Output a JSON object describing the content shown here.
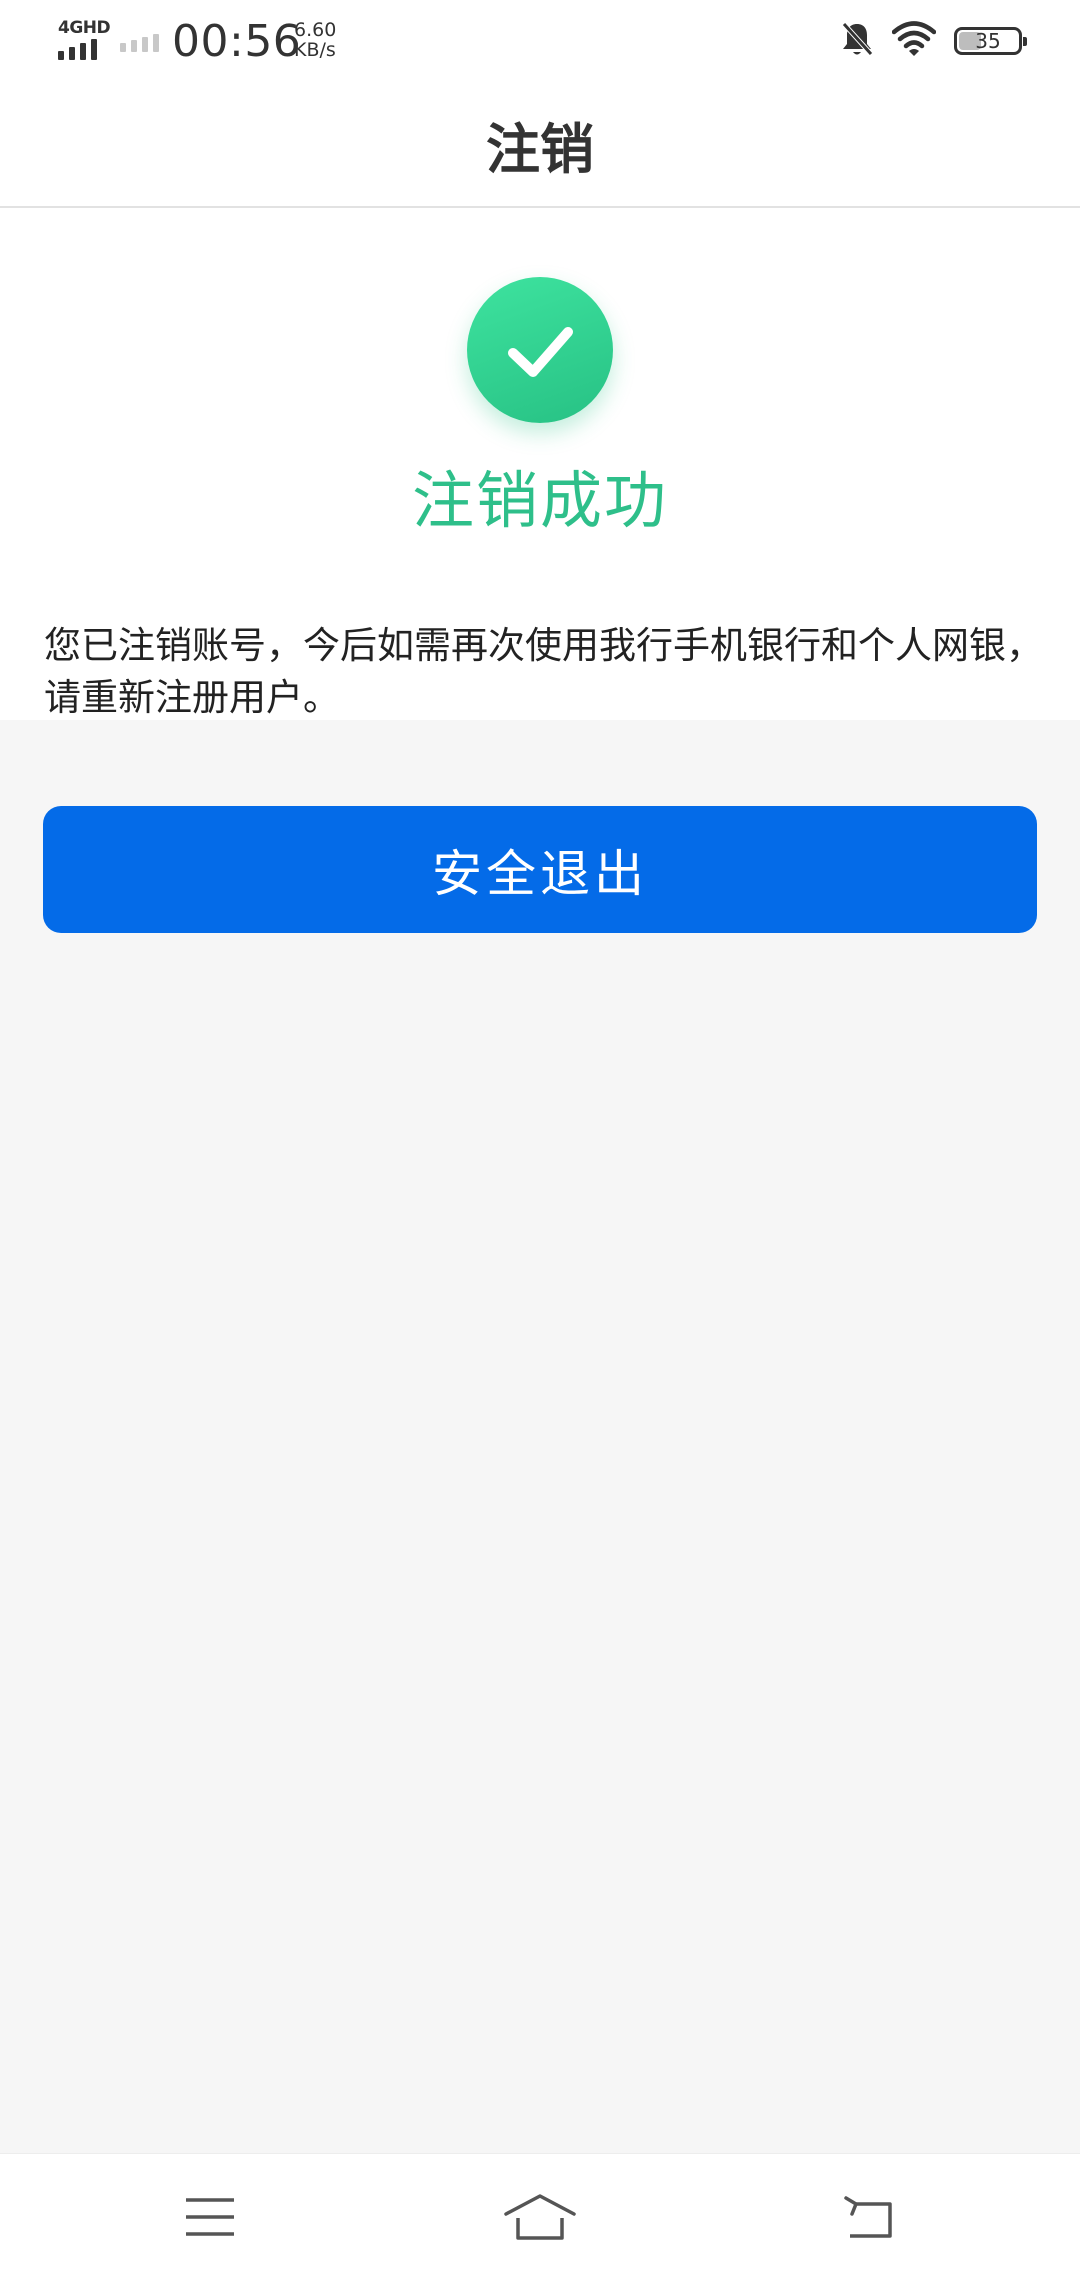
{
  "status_bar": {
    "network": "4GHD",
    "time": "00:56",
    "speed_value": "6.60",
    "speed_unit": "KB/s",
    "battery": "35",
    "battery_level": 0.35,
    "icons": [
      "signal-icon",
      "mute-bell-icon",
      "wifi-icon",
      "battery-icon"
    ]
  },
  "header": {
    "title": "注销"
  },
  "result": {
    "icon": "check-icon",
    "title": "注销成功",
    "message": "您已注销账号，今后如需再次使用我行手机银行和个人网银，请重新注册用户。"
  },
  "actions": {
    "exit_label": "安全退出"
  },
  "navigation": {
    "icons": [
      "menu-icon",
      "home-icon",
      "back-icon"
    ]
  },
  "colors": {
    "accent_blue": "#046be8",
    "success_green": "#2ebf8a",
    "background": "#f6f6f6"
  }
}
